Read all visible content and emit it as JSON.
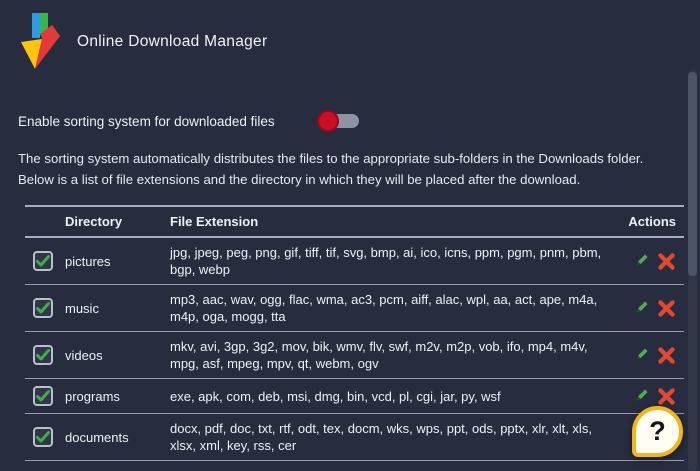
{
  "app": {
    "title": "Online Download Manager"
  },
  "settings": {
    "toggle_label": "Enable sorting system for downloaded files",
    "toggle_state": "off",
    "description": "The sorting system automatically distributes the files to the appropriate sub-folders in the Downloads folder. Below is a list of file extensions and the directory in which they will be placed after the download."
  },
  "table": {
    "headers": {
      "directory": "Directory",
      "extension": "File Extension",
      "actions": "Actions"
    },
    "rows": [
      {
        "directory": "pictures",
        "extensions": "jpg, jpeg, peg, png, gif, tiff, tif, svg, bmp, ai, ico, icns, ppm, pgm, pnm, pbm, bgp, webp",
        "checked": true
      },
      {
        "directory": "music",
        "extensions": "mp3, aac, wav, ogg, flac, wma, ac3, pcm, aiff, alac, wpl, aa, act, ape, m4a, m4p, oga, mogg, tta",
        "checked": true
      },
      {
        "directory": "videos",
        "extensions": "mkv, avi, 3gp, 3g2, mov, bik, wmv, flv, swf, m2v, m2p, vob, ifo, mp4, m4v, mpg, asf, mpeg, mpv, qt, webm, ogv",
        "checked": true
      },
      {
        "directory": "programs",
        "extensions": "exe, apk, com, deb, msi, dmg, bin, vcd, pl, cgi, jar, py, wsf",
        "checked": true
      },
      {
        "directory": "documents",
        "extensions": "docx, pdf, doc, txt, rtf, odt, tex, docm, wks, wps, ppt, ods, pptx, xlr, xlt, xls, xlsx, xml, key, rss, cer",
        "checked": true
      }
    ]
  },
  "help": {
    "label": "?"
  },
  "icons": {
    "logo": "download-arrow",
    "checkbox": "green-checkmark",
    "edit": "pencil",
    "delete": "x-mark",
    "help": "question-mark"
  },
  "colors": {
    "background": "#272c3e",
    "toggle_off_knob": "#c81024",
    "toggle_track": "#8d93a5",
    "check_green": "#3fae4a",
    "edit_green": "#4caf50",
    "delete_red": "#e2492e",
    "help_border": "#f2b51c",
    "logo_blue": "#2c9ce2",
    "logo_green": "#3bb54a",
    "logo_red": "#e23a3a",
    "logo_yellow": "#fdc40f",
    "table_line": "#a6adc0",
    "scroll_thumb": "#4d5466"
  }
}
